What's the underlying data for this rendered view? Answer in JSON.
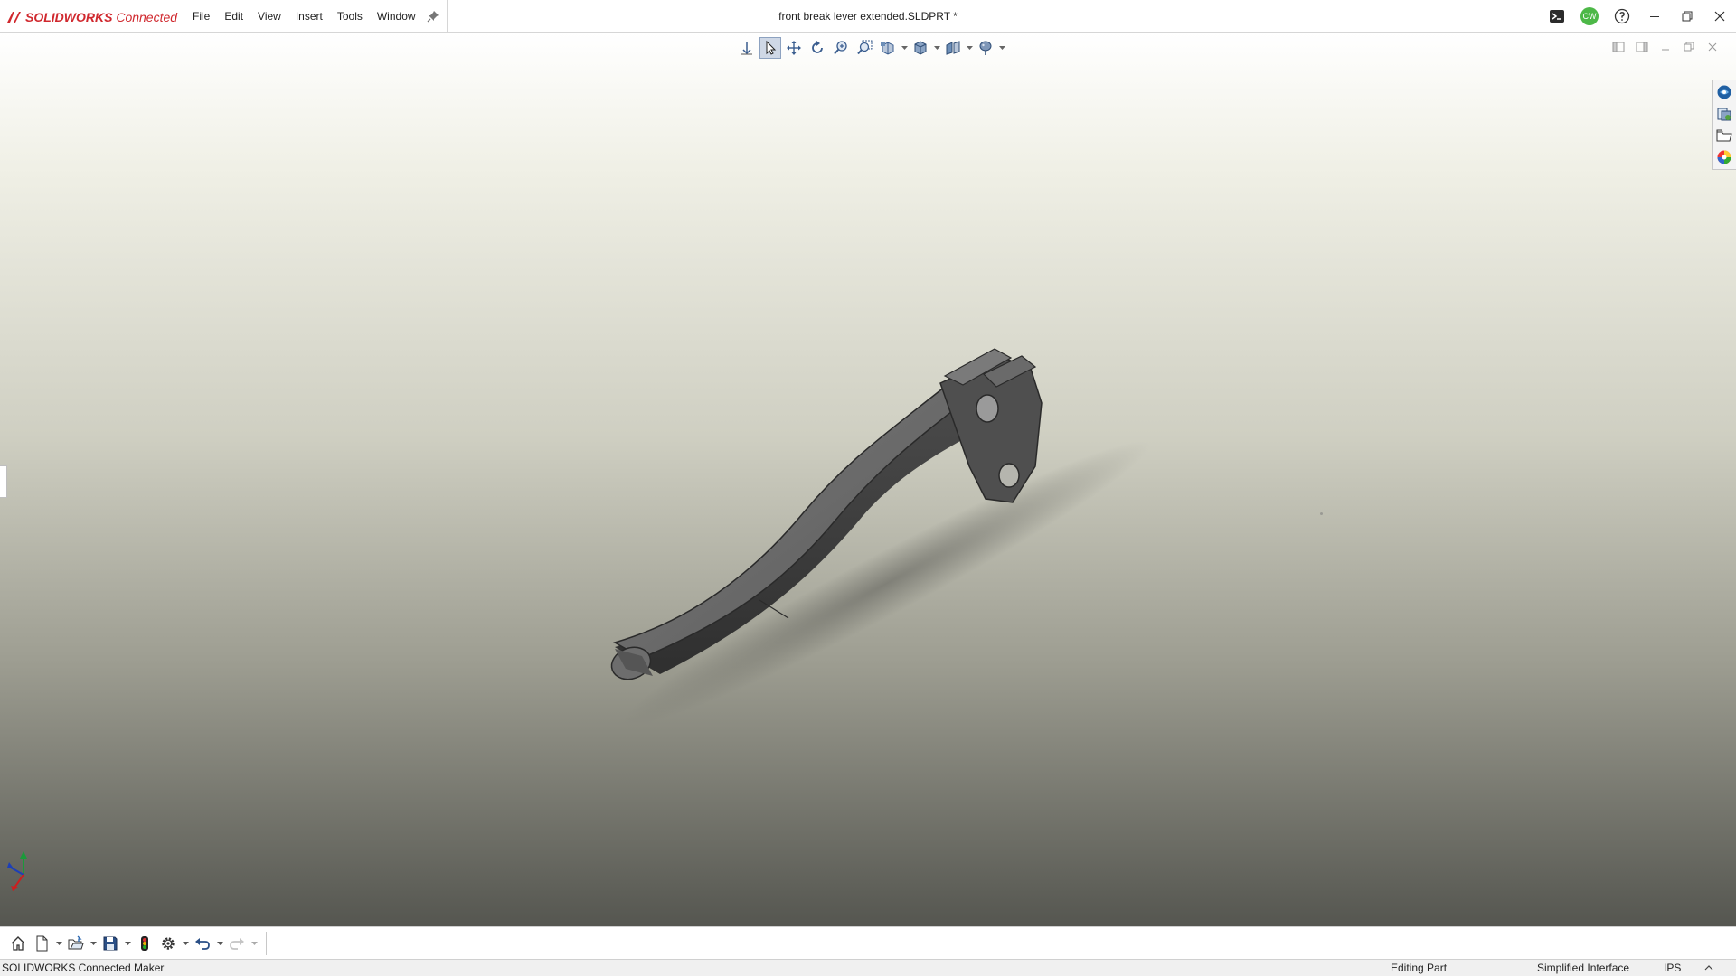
{
  "app": {
    "brand_bold": "SOLIDWORKS",
    "brand_rest": " Connected",
    "document_title": "front break lever extended.SLDPRT *"
  },
  "menu": {
    "items": [
      "File",
      "Edit",
      "View",
      "Insert",
      "Tools",
      "Window"
    ]
  },
  "title_right": {
    "avatar_initials": "CW",
    "icons": [
      "command-prompt-icon",
      "user-avatar",
      "help-icon",
      "minimize-icon",
      "restore-icon",
      "close-icon"
    ]
  },
  "heads_up_toolbar": {
    "buttons": [
      "view-orientation-icon",
      "select-icon",
      "pan-icon",
      "rotate-icon",
      "zoom-in-out-icon",
      "zoom-to-area-icon",
      "section-view-icon",
      "display-style-icon",
      "hide-show-icon",
      "appearance-icon"
    ]
  },
  "task_pane": {
    "buttons": [
      "solidworks-resources-icon",
      "design-library-icon",
      "file-explorer-icon",
      "appearances-icon"
    ]
  },
  "quick_access": {
    "buttons": [
      "home-icon",
      "new-document-icon",
      "open-icon",
      "save-icon",
      "traffic-light-icon",
      "options-icon",
      "undo-icon",
      "redo-icon"
    ]
  },
  "status": {
    "product": "SOLIDWORKS Connected Maker",
    "mode": "Editing Part",
    "interface": "Simplified Interface",
    "units": "IPS"
  },
  "colors": {
    "brand_red": "#d0282e",
    "avatar_green": "#4db848",
    "active_button": "#cfd8e6",
    "part_gray": "#5d5d5d"
  }
}
